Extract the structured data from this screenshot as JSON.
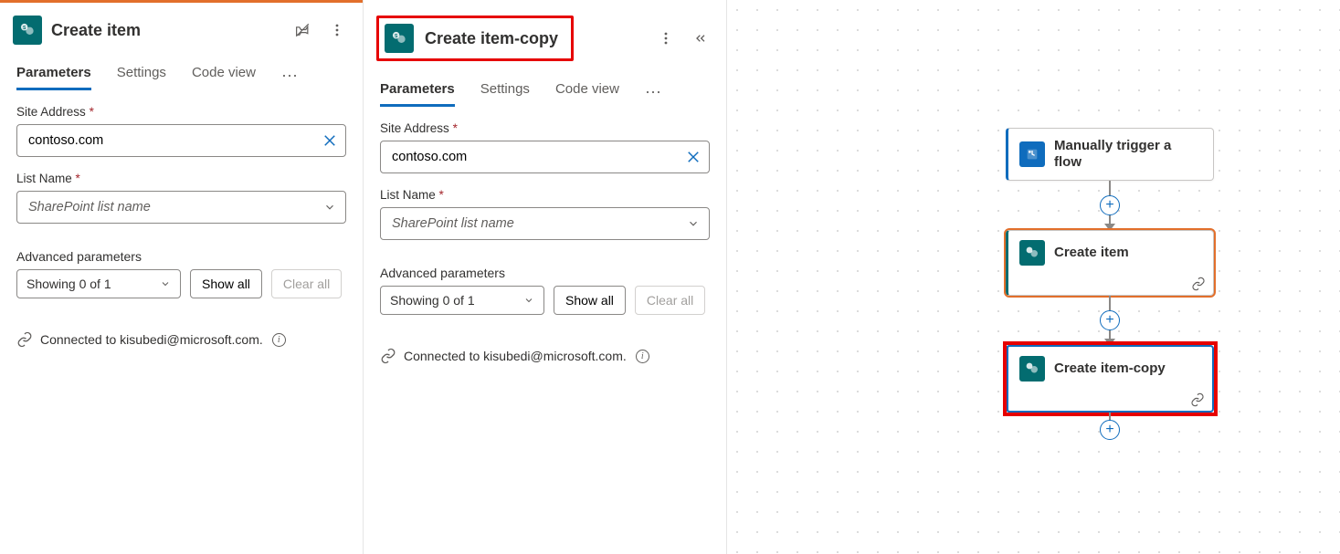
{
  "panel1": {
    "title": "Create item",
    "tabs": {
      "parameters": "Parameters",
      "settings": "Settings",
      "codeview": "Code view"
    },
    "fields": {
      "siteAddress": {
        "label": "Site Address",
        "value": "contoso.com"
      },
      "listName": {
        "label": "List Name",
        "placeholder": "SharePoint list name"
      }
    },
    "advanced": {
      "label": "Advanced parameters",
      "summary": "Showing 0 of 1",
      "showAll": "Show all",
      "clearAll": "Clear all"
    },
    "connected": "Connected to kisubedi@microsoft.com."
  },
  "panel2": {
    "title": "Create item-copy",
    "tabs": {
      "parameters": "Parameters",
      "settings": "Settings",
      "codeview": "Code view"
    },
    "fields": {
      "siteAddress": {
        "label": "Site Address",
        "value": "contoso.com"
      },
      "listName": {
        "label": "List Name",
        "placeholder": "SharePoint list name"
      }
    },
    "advanced": {
      "label": "Advanced parameters",
      "summary": "Showing 0 of 1",
      "showAll": "Show all",
      "clearAll": "Clear all"
    },
    "connected": "Connected to kisubedi@microsoft.com."
  },
  "canvas": {
    "nodes": {
      "trigger": "Manually trigger a flow",
      "action1": "Create item",
      "action2": "Create item-copy"
    }
  }
}
